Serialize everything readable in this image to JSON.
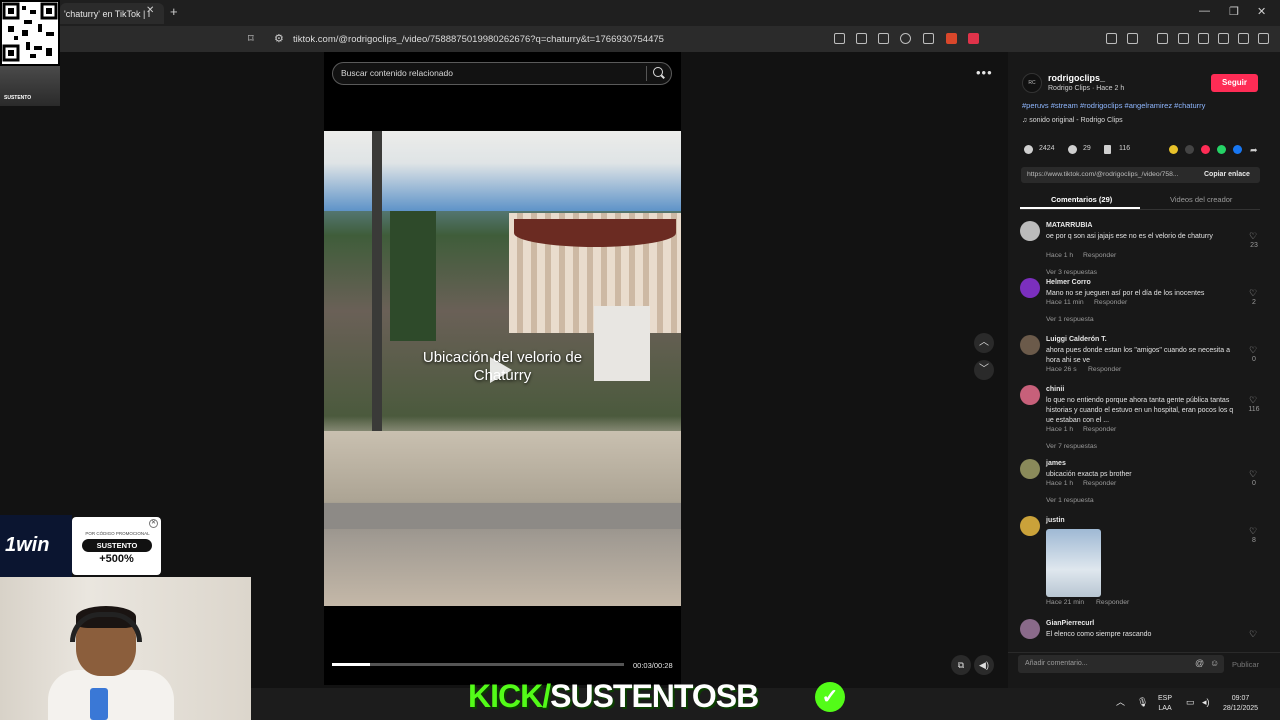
{
  "browser": {
    "tab_title": "'chaturry' en TikTok | I",
    "url": "tiktok.com/@rodrigoclips_/video/7588875019980262676?q=chaturry&t=1766930754475"
  },
  "search": {
    "placeholder": "Buscar contenido relacionado"
  },
  "video": {
    "caption_line1": "Ubicación del velorio de",
    "caption_line2": "Chaturry",
    "time": "00:03/00:28",
    "progress": 0.13
  },
  "post": {
    "username": "rodrigoclips_",
    "subtitle": "Rodrigo Clips · Hace 2 h",
    "avatar_text": "RC",
    "follow_label": "Seguir",
    "tags": "#peruvs #stream #rodrigoclips #angelramirez #chaturry",
    "sound": "sonido original - Rodrigo Clips",
    "likes": "2424",
    "comments": "29",
    "saves": "116",
    "link": "https://www.tiktok.com/@rodrigoclips_/video/758...",
    "copy_label": "Copiar enlace",
    "tab_comments": "Comentarios (29)",
    "tab_videos": "Videos del creador"
  },
  "comments": [
    {
      "name": "MATARRUBIA",
      "text": "oe por q son asi jajajs ese no es el velorio de chaturry",
      "time": "Hace 1 h",
      "reply": "Responder",
      "replies": "Ver 3 respuestas",
      "likes": "23",
      "color": "#bbbbbb"
    },
    {
      "name": "Helmer Corro",
      "text": "Mano no se jueguen así por el día de los inocentes",
      "time": "Hace 11 min",
      "reply": "Responder",
      "replies": "Ver 1 respuesta",
      "likes": "2",
      "color": "#7b2fbe"
    },
    {
      "name": "Luiggi Calderón T.",
      "text": "ahora pues donde estan los \"amigos\" cuando se necesita a hora ahi se ve",
      "time": "Hace 26 s",
      "reply": "Responder",
      "replies": "",
      "likes": "0",
      "color": "#6b5a4a"
    },
    {
      "name": "chinii",
      "text": "lo que no entiendo porque ahora tanta gente pública tantas historias y cuando el estuvo en un hospital, eran pocos los q ue estaban con el ...",
      "time": "Hace 1 h",
      "reply": "Responder",
      "replies": "Ver 7 respuestas",
      "likes": "116",
      "color": "#c7607a"
    },
    {
      "name": "james",
      "text": "ubicación exacta ps brother",
      "time": "Hace 1 h",
      "reply": "Responder",
      "replies": "Ver 1 respuesta",
      "likes": "0",
      "color": "#8a8a5a"
    },
    {
      "name": "justin",
      "text": "",
      "time": "Hace 21 min",
      "reply": "Responder",
      "replies": "",
      "likes": "8",
      "color": "#caa23a"
    },
    {
      "name": "GianPierrecurl",
      "text": "El elenco como siempre rascando",
      "time": "",
      "reply": "",
      "replies": "",
      "likes": "",
      "color": "#8a6a8a"
    }
  ],
  "compose": {
    "placeholder": "Añadir comentario...",
    "publish": "Publicar"
  },
  "overlay": {
    "brand": "1win",
    "promo_small": "POR CÓDIGO PROMOCIONAL",
    "promo_code": "SUSTENTO",
    "promo_pct": "+500%",
    "qr_label": "SUSTENTO",
    "banner_green": "KICK/",
    "banner_white": "SUSTENTOSB"
  },
  "tray": {
    "lang1": "ESP",
    "lang2": "LAA",
    "time": "09:07",
    "date": "28/12/2025"
  }
}
